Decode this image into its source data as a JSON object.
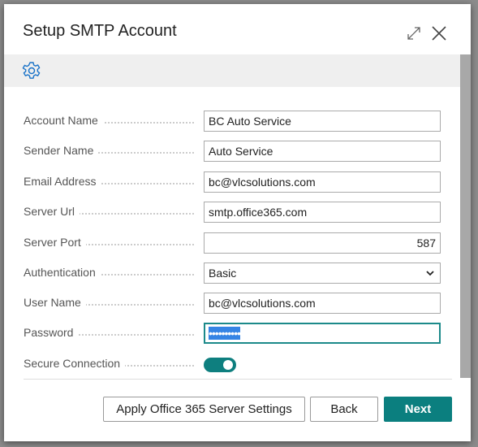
{
  "dialog": {
    "title": "Setup SMTP Account"
  },
  "fields": [
    {
      "label": "Account Name",
      "value": "BC Auto Service"
    },
    {
      "label": "Sender Name",
      "value": "Auto Service"
    },
    {
      "label": "Email Address",
      "value": "bc@vlcsolutions.com"
    },
    {
      "label": "Server Url",
      "value": "smtp.office365.com"
    },
    {
      "label": "Server Port",
      "value": "587"
    },
    {
      "label": "Authentication",
      "value": "Basic"
    },
    {
      "label": "User Name",
      "value": "bc@vlcsolutions.com"
    },
    {
      "label": "Password",
      "value": "••••••••••"
    },
    {
      "label": "Secure Connection",
      "value": true
    }
  ],
  "buttons": {
    "apply": "Apply Office 365 Server Settings",
    "back": "Back",
    "next": "Next"
  },
  "colors": {
    "accent": "#0b7f7f",
    "icon": "#1a73c8"
  }
}
